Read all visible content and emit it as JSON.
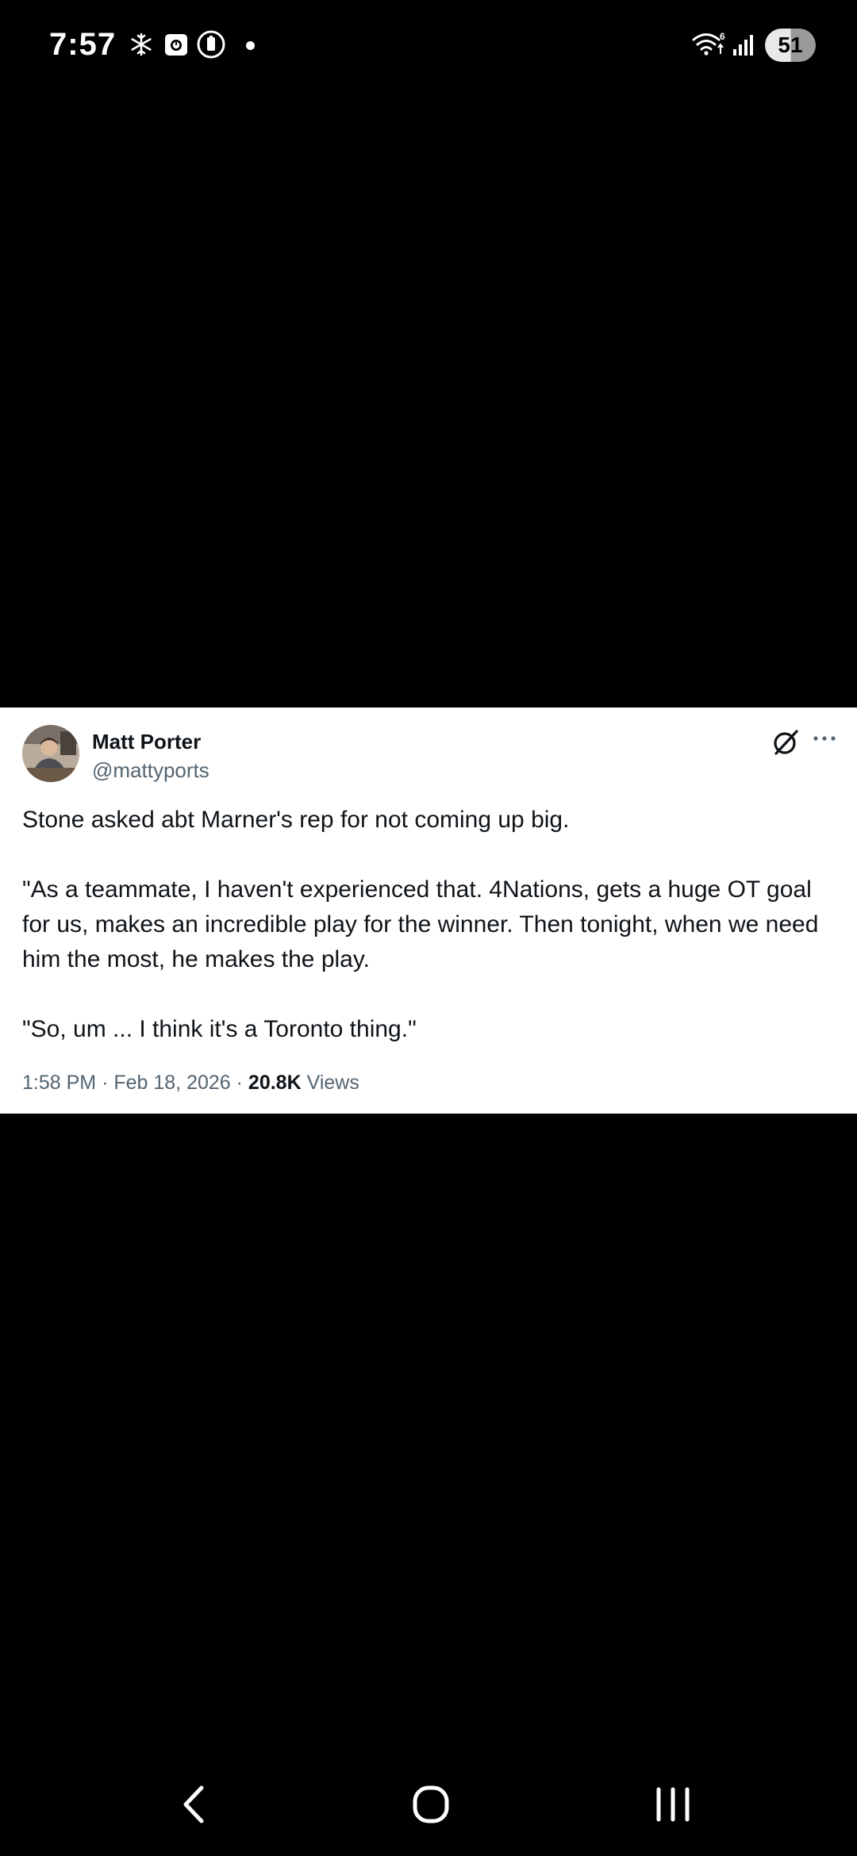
{
  "status_bar": {
    "time": "7:57",
    "battery": "51",
    "icons": [
      "snowflake-icon",
      "camera-notification-icon",
      "power-saving-icon",
      "notification-dot",
      "wifi-icon",
      "signal-icon",
      "battery-icon"
    ]
  },
  "tweet": {
    "author_name": "Matt Porter",
    "author_handle": "@mattyports",
    "paragraphs": [
      "Stone asked abt Marner's rep for not coming up big.",
      "\"As a teammate, I haven't experienced that. 4Nations, gets a huge OT goal for us, makes an incredible play for the winner. Then tonight, when we need him the most, he makes the play.",
      "\"So, um ... I think it's a Toronto thing.\""
    ],
    "time": "1:58 PM",
    "separator": "·",
    "date": "Feb 18, 2026",
    "views_count": "20.8K",
    "views_label": "Views"
  },
  "colors": {
    "background": "#000000",
    "card_background": "#ffffff",
    "primary_text": "#0f1419",
    "secondary_text": "#536471"
  },
  "nav_bar": {
    "buttons": [
      "back-icon",
      "home-icon",
      "recents-icon"
    ]
  }
}
